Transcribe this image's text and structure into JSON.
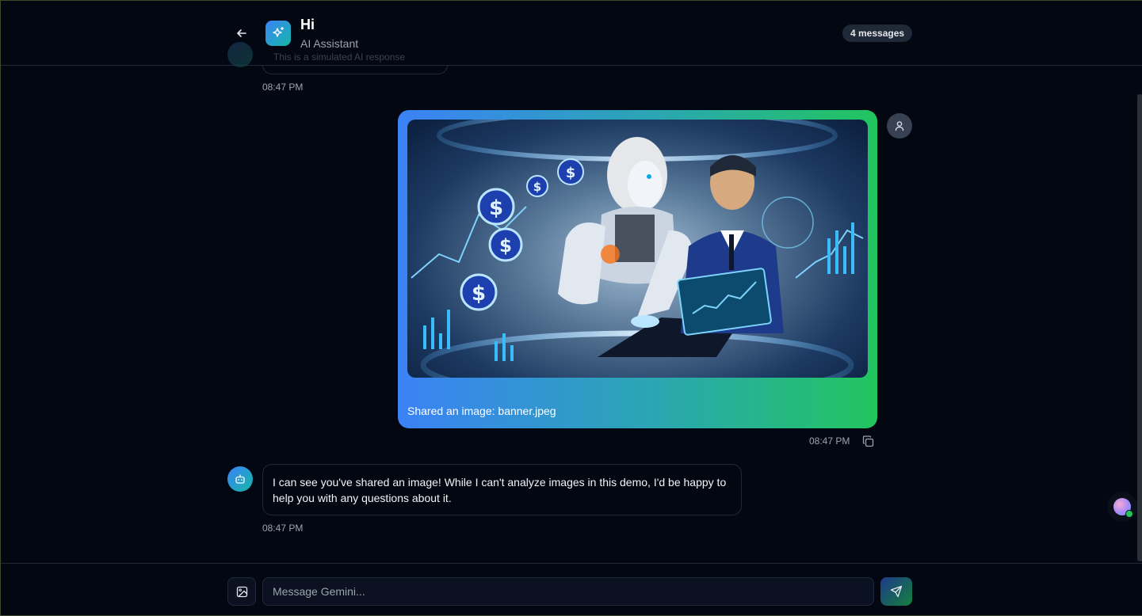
{
  "header": {
    "title": "Hi",
    "subtitle": "AI Assistant",
    "message_count": "4 messages",
    "back_icon": "arrow-left-icon",
    "logo_icon": "sparkles-icon"
  },
  "previous_message": {
    "text": "This is a simulated AI response",
    "time": "08:47 PM"
  },
  "user_message": {
    "caption": "Shared an image: banner.jpeg",
    "time": "08:47 PM",
    "image_description_icon": "robot-and-businessman-image",
    "avatar_icon": "user-icon",
    "copy_icon": "copy-icon"
  },
  "assistant_message": {
    "text": "I can see you've shared an image! While I can't analyze images in this demo, I'd be happy to help you with any questions about it.",
    "time": "08:47 PM",
    "avatar_icon": "bot-icon"
  },
  "composer": {
    "placeholder": "Message Gemini...",
    "value": "",
    "upload_icon": "image-icon",
    "send_icon": "send-icon"
  },
  "colors": {
    "background": "#030712",
    "accent_blue": "#3b82f6",
    "accent_green": "#22c55e",
    "border": "#1f2937"
  }
}
